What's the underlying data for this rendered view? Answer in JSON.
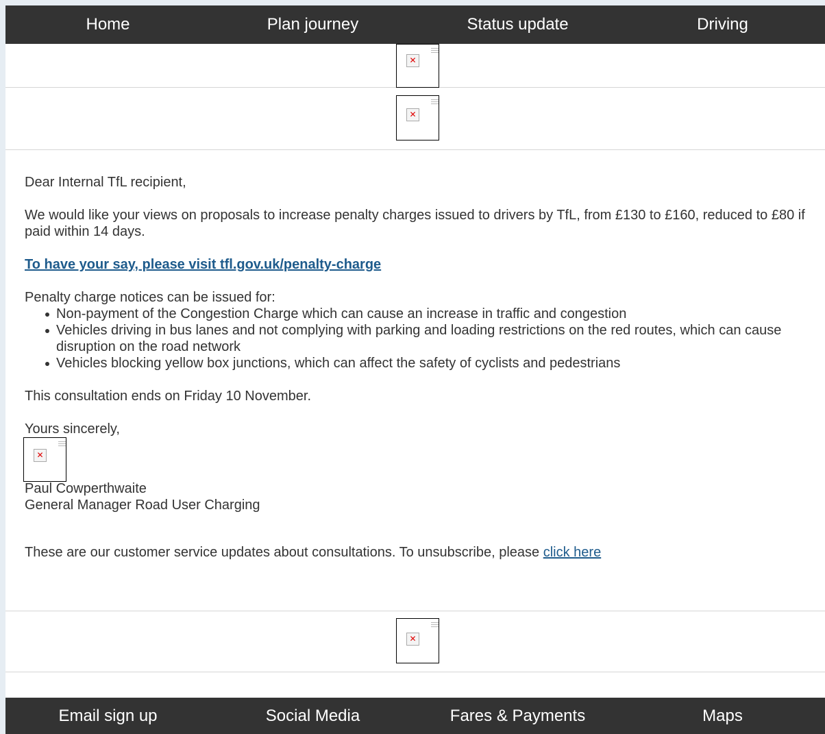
{
  "header_nav": {
    "items": [
      "Home",
      "Plan journey",
      "Status update",
      "Driving"
    ]
  },
  "email": {
    "greeting": "Dear Internal TfL recipient,",
    "intro": "We would like your views on proposals to increase penalty charges issued to drivers by TfL, from £130 to £160, reduced to £80 if paid within 14 days.",
    "cta_link": "To have your say, please visit tfl.gov.uk/penalty-charge",
    "list_intro": "Penalty charge notices can be issued for:",
    "reasons": [
      "Non-payment of the Congestion Charge which can cause an increase in traffic and congestion",
      "Vehicles driving in bus lanes and not complying with parking and loading restrictions on the red routes, which can cause disruption on the road network",
      "Vehicles blocking yellow box junctions, which can affect the safety of cyclists and pedestrians"
    ],
    "closing_date": "This consultation ends on Friday 10 November.",
    "signoff": "Yours sincerely,",
    "signatory_name": "Paul Cowperthwaite",
    "signatory_title": "General Manager Road User Charging",
    "unsubscribe_text": "These are our customer service updates about consultations. To unsubscribe, please ",
    "unsubscribe_link": "click here"
  },
  "footer_nav": {
    "items": [
      "Email sign up",
      "Social Media",
      "Fares & Payments",
      "Maps"
    ]
  },
  "icons": {
    "broken_image": "broken-image-icon"
  },
  "colors": {
    "nav_bg": "#333333",
    "link": "#1e5b8c",
    "text": "#333333"
  }
}
